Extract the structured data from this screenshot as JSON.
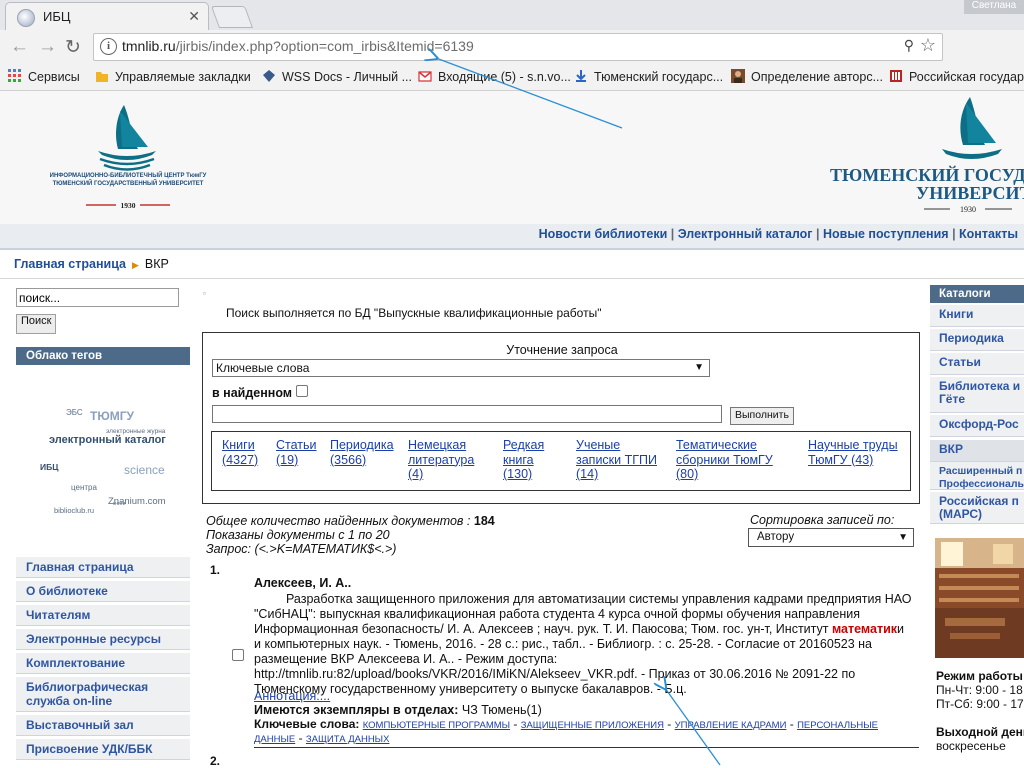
{
  "browser": {
    "tab_title": "ИБЦ",
    "user": "Светлана",
    "url_host": "tmnlib.ru",
    "url_rest": "/jirbis/index.php?option=com_irbis&Itemid=6139",
    "bookmarks": [
      {
        "label": "Сервисы",
        "icon": "apps-icon"
      },
      {
        "label": "Управляемые закладки",
        "icon": "folder-icon"
      },
      {
        "label": "WSS Docs - Личный ...",
        "icon": "wss-icon"
      },
      {
        "label": "Входящие (5) - s.n.vo...",
        "icon": "gmail-icon"
      },
      {
        "label": "Тюменский государс...",
        "icon": "download-icon"
      },
      {
        "label": "Определение авторс...",
        "icon": "portrait-icon"
      },
      {
        "label": "Российская государс...",
        "icon": "library-icon"
      }
    ]
  },
  "header": {
    "left_logo_text": "ИНФОРМАЦИОННО-БИБЛИОТЕЧНЫЙ ЦЕНТР ТюмГУ",
    "left_logo_sub": "ТЮМЕНСКИЙ ГОСУДАРСТВЕННЫЙ УНИВЕРСИТЕТ",
    "left_logo_year": "1930",
    "right_logo_line1": "ТЮМЕНСКИЙ ГОСУДАРСТВЕННЫЙ",
    "right_logo_line2": "УНИВЕРСИТЕТ",
    "right_logo_year": "1930",
    "nav": [
      "Новости библиотеки",
      "Электронный каталог",
      "Новые поступления",
      "Контакты"
    ]
  },
  "breadcrumb": {
    "home": "Главная страница",
    "current": "ВКР"
  },
  "left": {
    "search_value": "поиск...",
    "search_button": "Поиск",
    "tag_cloud_title": "Облако тегов",
    "tags": [
      "ЭБС",
      "ТЮМГУ",
      "электронные журна",
      "электронный каталог",
      "ИБЦ",
      "science",
      "центра",
      "Znanium.com",
      "biblioclub.ru",
      "книги"
    ],
    "menu": [
      "Главная страница",
      "О библиотеке",
      "Читателям",
      "Электронные ресурсы",
      "Комплектование",
      "Библиографическая служба on-line",
      "Выставочный зал",
      "Присвоение УДК/ББК"
    ]
  },
  "main": {
    "title": "Поиск выполняется по БД \"Выпускные квалификационные работы\"",
    "refine_title": "Уточнение запроса",
    "field_select": "Ключевые слова",
    "in_found_label": "в найденном",
    "run_button": "Выполнить",
    "facets": [
      {
        "label": "Книги",
        "count": "(4327)"
      },
      {
        "label": "Статьи",
        "count": "(19)"
      },
      {
        "label": "Периодика",
        "count": "(3566)"
      },
      {
        "label": "Немецкая литература",
        "count": "(4)"
      },
      {
        "label": "Редкая книга",
        "count": "(130)"
      },
      {
        "label": "Ученые записки ТГПИ",
        "count": "(14)"
      },
      {
        "label": "Тематические сборники ТюмГУ",
        "count": "(80)"
      },
      {
        "label": "Научные труды ТюмГУ",
        "count": "(43)"
      }
    ],
    "found_label": "Общее количество найденных документов :",
    "found_value": "184",
    "shown_text": "Показаны документы с 1 по 20",
    "query_text": "Запрос: (<.>K=МАТЕМАТИК$<.>)",
    "sort_label": "Сортировка записей по:",
    "sort_value": "Автору",
    "record": {
      "num": "1.",
      "author": "Алексеев, И. А..",
      "desc_before": "Разработка защищенного приложения для автоматизации системы управления кадрами предприятия НАО \"СибНАЦ\": выпускная квалификационная работа студента 4 курса очной формы обучения направления Информационная безопасность/ И. А. Алексеев ; науч. рук. Т. И. Паюсова; Тюм. гос. ун-т, Институт ",
      "desc_highlight": "математик",
      "desc_after": "и и компьютерных наук. - Тюмень, 2016. - 28 с.: рис., табл.. - Библиогр. : с. 25-28. - Согласие от 20160523 на размещение ВКР Алексеева И. А.. - Режим доступа: http://tmnlib.ru:82/upload/books/VKR/2016/IMiKN/Alekseev_VKR.pdf. - Приказ от 30.06.2016 № 2091-22 по Тюменскому государственному университету о выпуске бакалавров. - Б.ц.",
      "annotation": "Аннотация:...",
      "copies_label": "Имеются экземпляры в отделах:",
      "copies_value": "ЧЗ Тюмень(1)",
      "keywords_label": "Ключевые слова:",
      "keywords": [
        "КОМПЬЮТЕРНЫЕ ПРОГРАММЫ",
        "ЗАЩИЩЕННЫЕ ПРИЛОЖЕНИЯ",
        "УПРАВЛЕНИЕ КАДРАМИ",
        "ПЕРСОНАЛЬНЫЕ ДАННЫЕ",
        "ЗАЩИТА ДАННЫХ"
      ]
    },
    "record2_num": "2."
  },
  "right": {
    "head": "Каталоги",
    "items": [
      "Книги",
      "Периодика",
      "Статьи",
      "Библиотека и Гёте",
      "Оксфорд-Рос",
      "ВКР",
      "Расширенный п Профессиональ",
      "Российская п (МАРС)"
    ],
    "hours_title": "Режим работы",
    "hours_1": "Пн-Чт: 9:00 - 18",
    "hours_2": "Пт-Сб: 9:00 - 17",
    "day_off_title": "Выходной день",
    "day_off": "воскресенье"
  },
  "colors": {
    "link": "#1f4f96",
    "panel_head": "#4d6a89",
    "highlight": "#cc0000",
    "annotation_arrow": "#2a8fd4"
  }
}
